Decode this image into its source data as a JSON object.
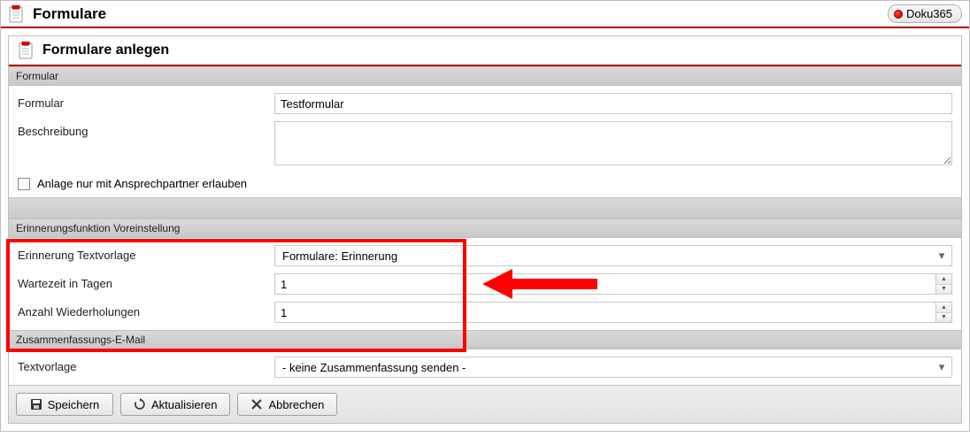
{
  "topbar": {
    "title": "Formulare",
    "badge": "Doku365"
  },
  "panel": {
    "title": "Formulare anlegen"
  },
  "section1": {
    "title": "Formular",
    "formular_label": "Formular",
    "formular_value": "Testformular",
    "beschreibung_label": "Beschreibung",
    "beschreibung_value": "",
    "checkbox_label": "Anlage nur mit Ansprechpartner erlauben"
  },
  "section2": {
    "title": "Erinnerungsfunktion Voreinstellung",
    "textvorlage_label": "Erinnerung Textvorlage",
    "textvorlage_value": "Formulare: Erinnerung",
    "wartezeit_label": "Wartezeit in Tagen",
    "wartezeit_value": "1",
    "wiederholungen_label": "Anzahl Wiederholungen",
    "wiederholungen_value": "1"
  },
  "section3": {
    "title": "Zusammenfassungs-E-Mail",
    "textvorlage_label": "Textvorlage",
    "textvorlage_value": "- keine Zusammenfassung senden -"
  },
  "footer": {
    "save": "Speichern",
    "refresh": "Aktualisieren",
    "cancel": "Abbrechen"
  }
}
